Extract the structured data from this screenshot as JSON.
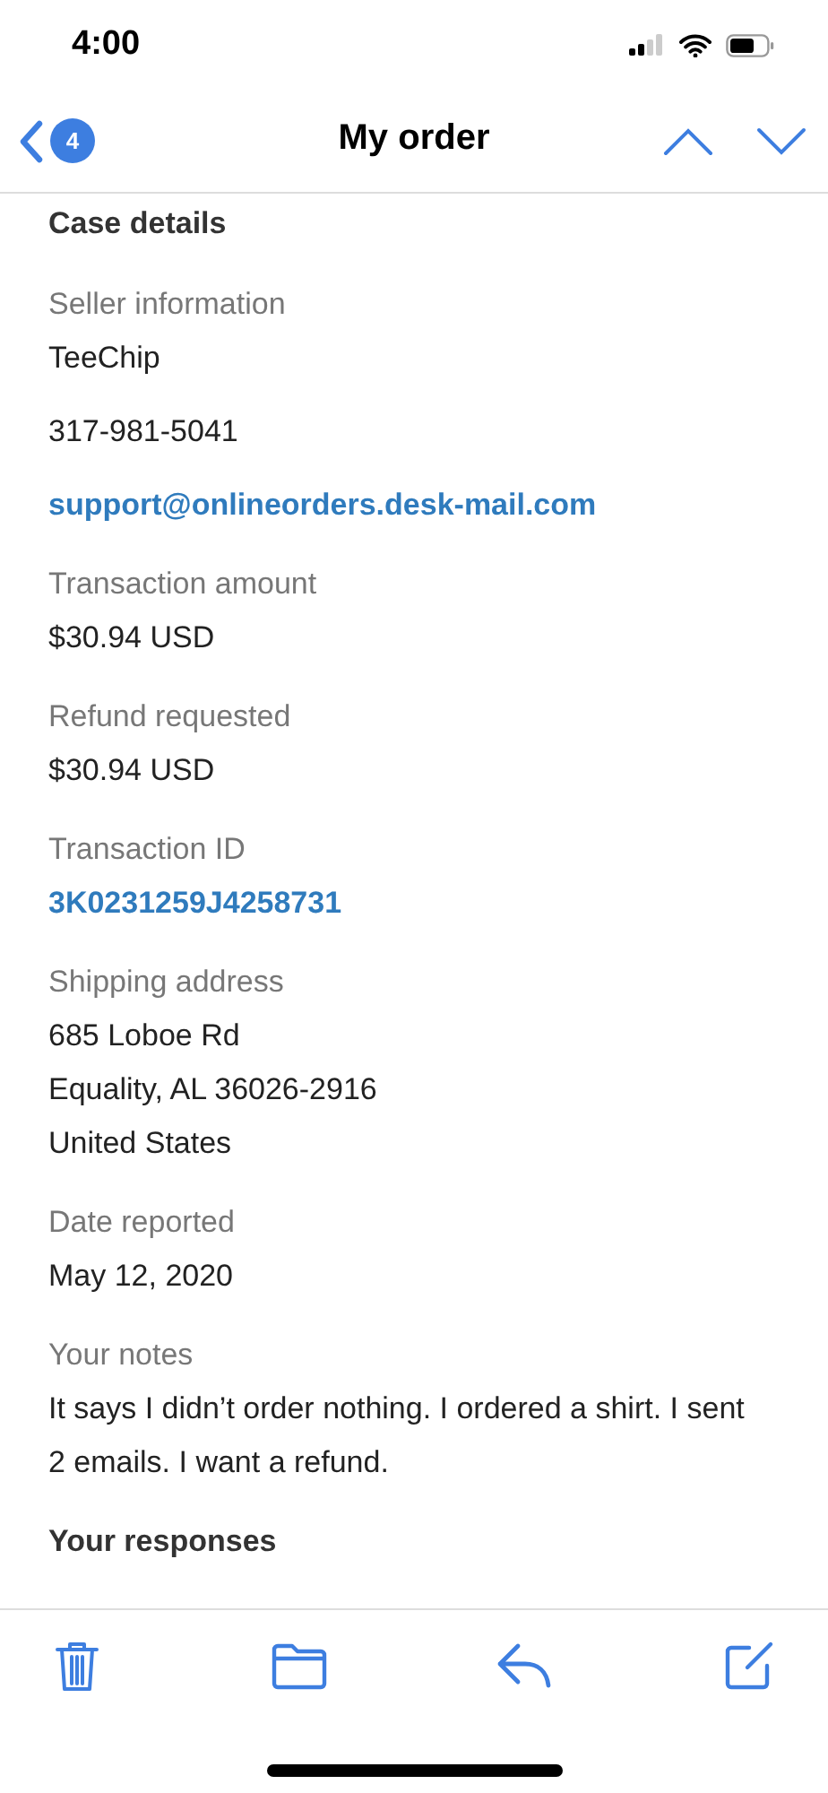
{
  "status_bar": {
    "time": "4:00"
  },
  "nav": {
    "badge": "4",
    "title": "My order"
  },
  "heading": "Case details",
  "sections": [
    {
      "label": "Seller information",
      "values": [
        {
          "kind": "text",
          "lines": [
            "TeeChip"
          ]
        },
        {
          "kind": "text",
          "lines": [
            "317-981-5041"
          ]
        },
        {
          "kind": "link",
          "lines": [
            "support@onlineorders.desk-mail.com"
          ]
        }
      ]
    },
    {
      "label": "Transaction amount",
      "values": [
        {
          "kind": "text",
          "lines": [
            "$30.94 USD"
          ]
        }
      ]
    },
    {
      "label": "Refund requested",
      "values": [
        {
          "kind": "text",
          "lines": [
            "$30.94 USD"
          ]
        }
      ]
    },
    {
      "label": "Transaction ID",
      "values": [
        {
          "kind": "link",
          "lines": [
            "3K0231259J4258731"
          ]
        }
      ]
    },
    {
      "label": "Shipping address",
      "values": [
        {
          "kind": "text",
          "lines": [
            "685 Loboe Rd",
            "Equality, AL 36026-2916",
            "United States"
          ]
        }
      ]
    },
    {
      "label": "Date reported",
      "values": [
        {
          "kind": "text",
          "lines": [
            "May 12, 2020"
          ]
        }
      ]
    },
    {
      "label": "Your notes",
      "values": [
        {
          "kind": "text",
          "lines": [
            "It says I didn’t order nothing. I ordered a shirt. I sent 2 emails. I want a refund."
          ]
        }
      ]
    }
  ],
  "cut_heading": "Your responses"
}
